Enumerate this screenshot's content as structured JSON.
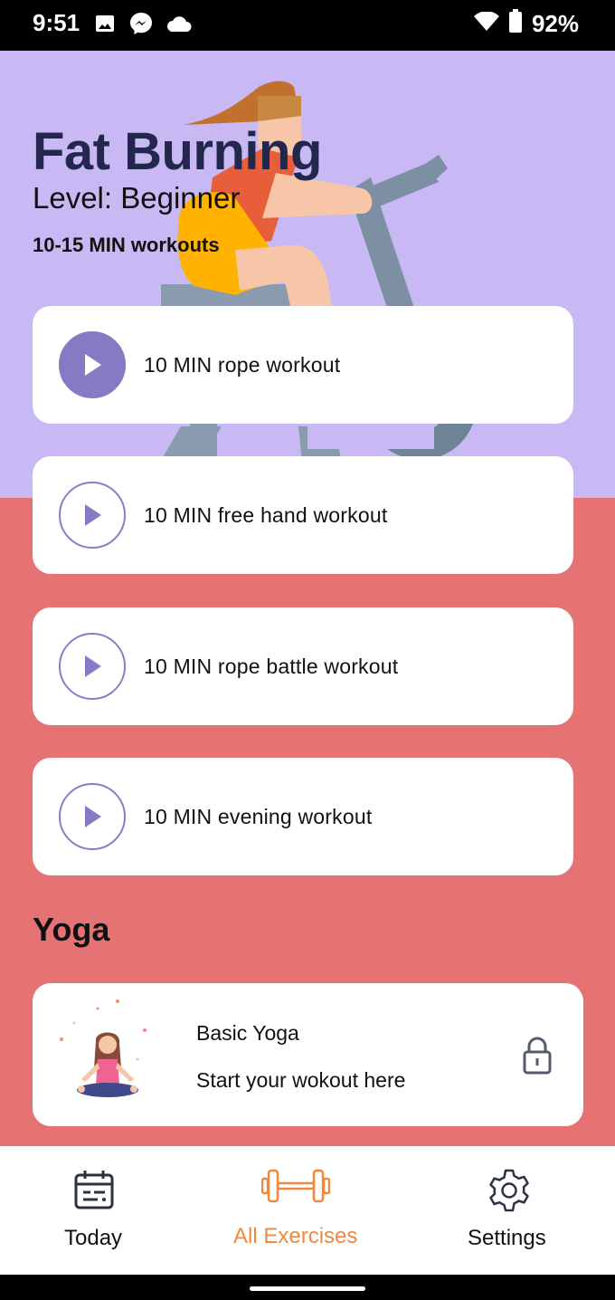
{
  "status": {
    "time": "9:51",
    "battery": "92%",
    "icons": [
      "image-icon",
      "messenger-icon",
      "cloud-icon",
      "wifi-icon",
      "battery-icon"
    ]
  },
  "hero": {
    "title": "Fat Burning",
    "level": "Level: Beginner",
    "duration": "10-15 MIN workouts"
  },
  "workouts": [
    {
      "label": "10 MIN rope workout",
      "active": true
    },
    {
      "label": "10 MIN free hand workout",
      "active": false
    },
    {
      "label": "10 MIN rope battle workout",
      "active": false
    },
    {
      "label": "10 MIN evening workout",
      "active": false
    }
  ],
  "yoga": {
    "section_title": "Yoga",
    "card_title": "Basic Yoga",
    "card_subtitle": "Start your wokout here",
    "locked": true
  },
  "nav": {
    "items": [
      {
        "label": "Today",
        "icon": "calendar-icon",
        "active": false
      },
      {
        "label": "All Exercises",
        "icon": "dumbbell-icon",
        "active": true
      },
      {
        "label": "Settings",
        "icon": "gear-icon",
        "active": false
      }
    ]
  },
  "colors": {
    "hero_bg": "#c8b8f4",
    "screen_bg": "#e57373",
    "accent_purple": "#857ac4",
    "active_nav": "#f0883e",
    "title_dark": "#23264d"
  }
}
